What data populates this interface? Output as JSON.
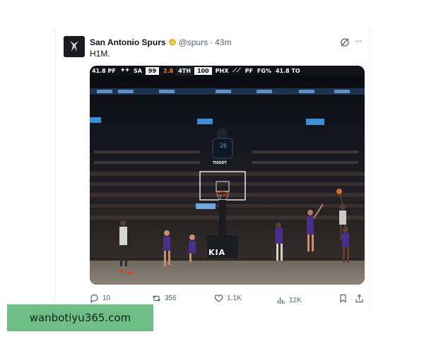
{
  "tweet": {
    "author": {
      "display_name": "San Antonio Spurs",
      "verified": true,
      "verified_color": "#e8b429",
      "handle": "@spurs",
      "separator": "·",
      "time": "43m"
    },
    "text": "H1M.",
    "icons": {
      "grok": "grok-icon",
      "more": "more-icon"
    },
    "more_glyph": "···"
  },
  "media": {
    "description_icon": "game-photo",
    "scorebug": {
      "left_stat": "41.8 PF",
      "spurs_logo_text": "SA",
      "spurs_score": "99",
      "clock": "2.8",
      "period": "4TH",
      "suns_score": "100",
      "suns_abbr": "PHX",
      "right_stat_1": "PF",
      "right_stat_2": "FG%",
      "right_stat_3": "41.8 TO"
    },
    "shot_clock": "26",
    "sign_tissot": "TISSOT",
    "sign_kia": "KIA"
  },
  "actions": {
    "reply": {
      "icon": "reply-icon",
      "count": "10"
    },
    "retweet": {
      "icon": "retweet-icon",
      "count": "356"
    },
    "like": {
      "icon": "heart-icon",
      "count": "1.1K"
    },
    "views": {
      "icon": "views-icon",
      "count": "12K"
    },
    "bookmark": {
      "icon": "bookmark-icon"
    },
    "share": {
      "icon": "share-icon"
    }
  },
  "watermark": "wanbotiyu365.com",
  "colors": {
    "text_primary": "#0f1419",
    "text_secondary": "#536471",
    "divider": "#eff3f4",
    "watermark_bg": "#6fbe88"
  }
}
